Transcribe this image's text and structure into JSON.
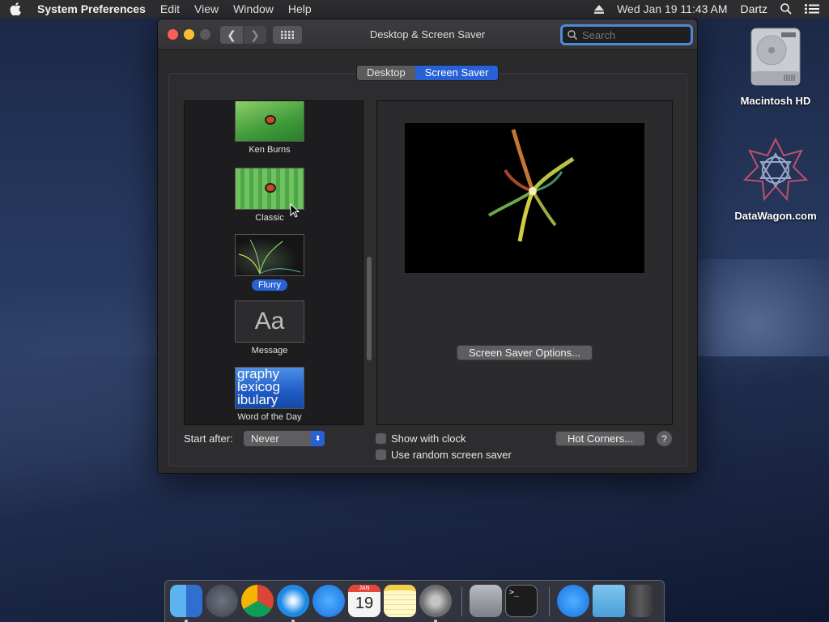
{
  "menubar": {
    "app_name": "System Preferences",
    "items": [
      "Edit",
      "View",
      "Window",
      "Help"
    ],
    "datetime": "Wed Jan 19  11:43 AM",
    "user": "Dartz"
  },
  "window": {
    "title": "Desktop & Screen Saver",
    "search_placeholder": "Search"
  },
  "tabs": [
    {
      "label": "Desktop",
      "active": false
    },
    {
      "label": "Screen Saver",
      "active": true
    }
  ],
  "savers": [
    {
      "label": "Ken Burns",
      "selected": false
    },
    {
      "label": "Classic",
      "selected": false
    },
    {
      "label": "Flurry",
      "selected": true
    },
    {
      "label": "Message",
      "selected": false,
      "thumb_text": "Aa"
    },
    {
      "label": "Word of the Day",
      "selected": false,
      "thumb_text": "graphy lexicog ibulary"
    }
  ],
  "options_button": "Screen Saver Options...",
  "start_after": {
    "label": "Start after:",
    "value": "Never"
  },
  "checkboxes": [
    {
      "label": "Show with clock",
      "checked": false
    },
    {
      "label": "Use random screen saver",
      "checked": false
    }
  ],
  "hot_corners_button": "Hot Corners...",
  "help_button": "?",
  "desktop_icons": [
    {
      "label": "Macintosh HD",
      "icon": "hard-drive-icon"
    },
    {
      "label": "DataWagon.com",
      "icon": "datawagon-logo-icon"
    }
  ],
  "dock": {
    "apps": [
      "finder",
      "launchpad",
      "chrome",
      "safari",
      "app-store",
      "calendar",
      "notes",
      "system-preferences",
      "disk-utility",
      "terminal",
      "downloads-app-store",
      "folder",
      "trash"
    ],
    "calendar_day": "19",
    "calendar_month": "JAN"
  },
  "colors": {
    "accent": "#2861d6",
    "window_bg": "#2a2a2c",
    "close": "#fd5e57",
    "minimize": "#febd2f"
  }
}
